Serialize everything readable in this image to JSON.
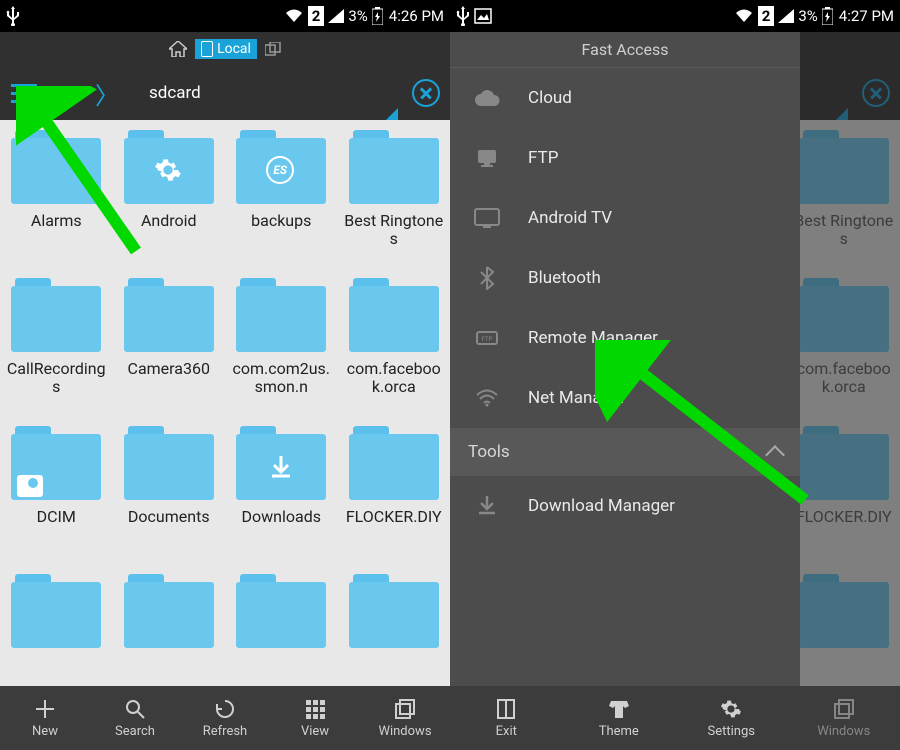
{
  "status": {
    "left": {
      "time": "4:26 PM",
      "battery": "3%",
      "sim": "2"
    },
    "right": {
      "time": "4:27 PM",
      "battery": "3%",
      "sim": "2"
    }
  },
  "path": {
    "home_label": "Local",
    "crumbs": {
      "root": "/",
      "current": "sdcard"
    }
  },
  "drawer": {
    "header": "Fast Access",
    "items": [
      {
        "icon": "cloud",
        "label": "Cloud"
      },
      {
        "icon": "ftp",
        "label": "FTP"
      },
      {
        "icon": "tv",
        "label": "Android TV"
      },
      {
        "icon": "bluetooth",
        "label": "Bluetooth"
      },
      {
        "icon": "remote",
        "label": "Remote Manager"
      },
      {
        "icon": "wifi",
        "label": "Net Manager"
      }
    ],
    "section": "Tools",
    "tools": [
      {
        "icon": "download",
        "label": "Download Manager"
      }
    ]
  },
  "folders": {
    "row1": [
      {
        "label": "Alarms"
      },
      {
        "label": "Android",
        "overlay": "gear"
      },
      {
        "label": "backups",
        "overlay": "es"
      },
      {
        "label": "Best Ringtones"
      }
    ],
    "row2": [
      {
        "label": "CallRecordings"
      },
      {
        "label": "Camera360"
      },
      {
        "label": "com.com2us.smon.n"
      },
      {
        "label": "com.facebook.orca"
      }
    ],
    "row3": [
      {
        "label": "DCIM",
        "overlay": "camera"
      },
      {
        "label": "Documents"
      },
      {
        "label": "Downloads",
        "overlay": "download"
      },
      {
        "label": "FLOCKER.DIY"
      }
    ]
  },
  "bottom": {
    "left": [
      {
        "icon": "plus",
        "label": "New"
      },
      {
        "icon": "search",
        "label": "Search"
      },
      {
        "icon": "refresh",
        "label": "Refresh"
      },
      {
        "icon": "grid",
        "label": "View"
      },
      {
        "icon": "windows",
        "label": "Windows"
      }
    ],
    "right": [
      {
        "icon": "exit",
        "label": "Exit"
      },
      {
        "icon": "theme",
        "label": "Theme"
      },
      {
        "icon": "settings",
        "label": "Settings"
      },
      {
        "icon": "windows",
        "label": "Windows"
      }
    ]
  },
  "colors": {
    "accent": "#1aa3d9",
    "folder": "#6ac8ee",
    "arrow": "#00d800"
  }
}
